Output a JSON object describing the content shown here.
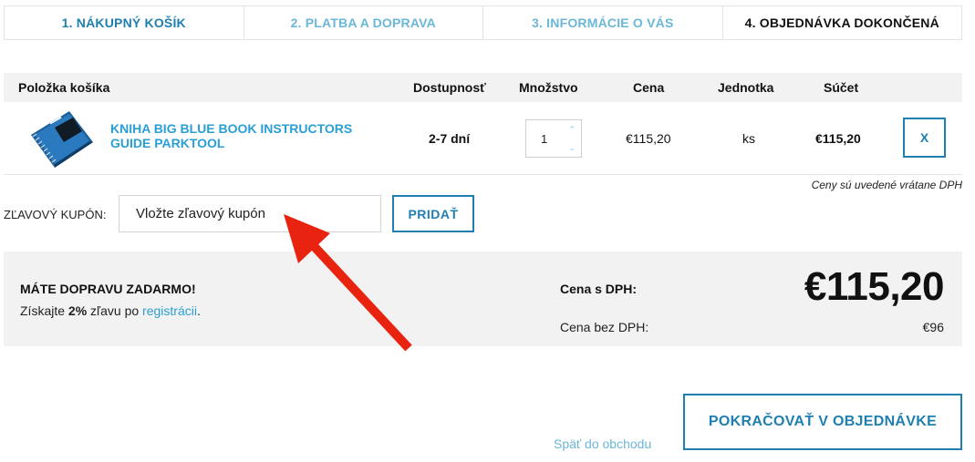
{
  "steps": [
    {
      "label": "1. NÁKUPNÝ KOŠÍK"
    },
    {
      "label": "2. PLATBA A DOPRAVA"
    },
    {
      "label": "3. INFORMÁCIE O VÁS"
    },
    {
      "label": "4. OBJEDNÁVKA DOKONČENÁ"
    }
  ],
  "table": {
    "headers": {
      "item": "Položka košíka",
      "availability": "Dostupnosť",
      "quantity": "Množstvo",
      "price": "Cena",
      "unit": "Jednotka",
      "sum": "Súčet"
    },
    "rows": [
      {
        "name": "KNIHA BIG BLUE BOOK INSTRUCTORS GUIDE PARKTOOL",
        "availability": "2-7 dní",
        "quantity": "1",
        "price": "€115,20",
        "unit": "ks",
        "sum": "€115,20",
        "remove_label": "X"
      }
    ]
  },
  "vat_note": "Ceny sú uvedené vrátane DPH",
  "coupon": {
    "label": "ZĽAVOVÝ KUPÓN:",
    "placeholder": "Vložte zľavový kupón",
    "button": "PRIDAŤ"
  },
  "summary": {
    "free_shipping_title": "MÁTE DOPRAVU ZADARMO!",
    "discount_prefix": "Získajte ",
    "discount_value": "2%",
    "discount_middle": " zľavu po ",
    "discount_link": "registrácii",
    "discount_suffix": ".",
    "incl_vat_label": "Cena s DPH:",
    "total": "€115,20",
    "excl_vat_label": "Cena bez DPH:",
    "excl_vat_value": "€96"
  },
  "footer": {
    "back_link": "Späť do obchodu",
    "continue_button": "POKRAČOVAŤ V OBJEDNÁVKE"
  },
  "colors": {
    "accent": "#1e7fb0",
    "link": "#2a9fd6",
    "arrow": "#e8230f"
  }
}
